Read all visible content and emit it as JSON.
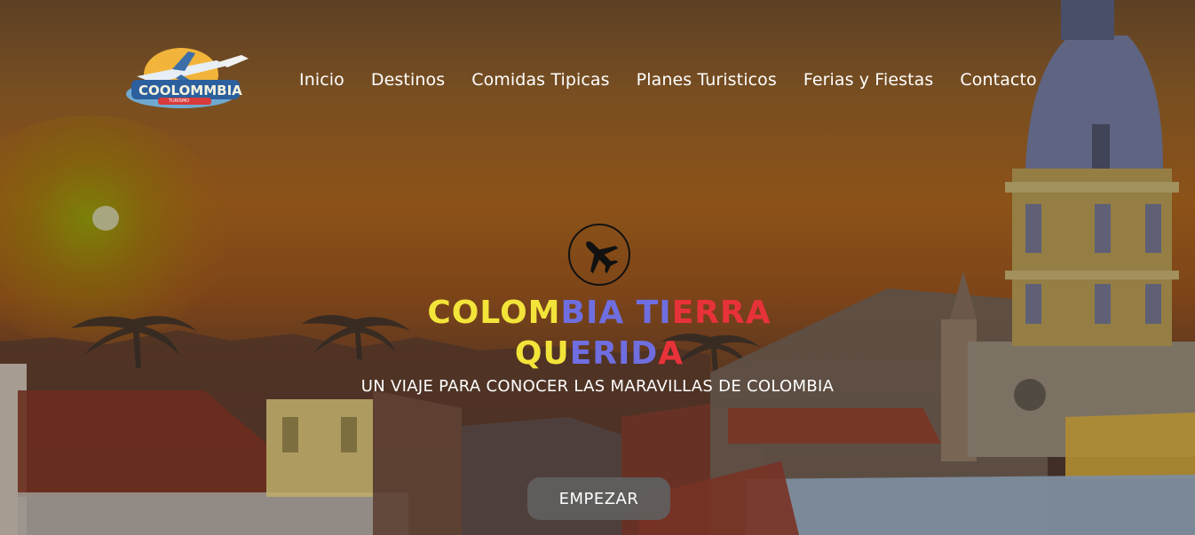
{
  "brand": {
    "logo_text": "COOLOMMBIA",
    "logo_tagline": "TURISMO",
    "logo_icon": "airplane-logo"
  },
  "nav": {
    "items": [
      {
        "label": "Inicio"
      },
      {
        "label": "Destinos"
      },
      {
        "label": "Comidas Tipicas"
      },
      {
        "label": "Planes Turisticos"
      },
      {
        "label": "Ferias y Fiestas"
      },
      {
        "label": "Contacto"
      }
    ]
  },
  "hero": {
    "icon": "airplane-icon",
    "title_line1": [
      "COLOM",
      "BIA TI",
      "ERRA"
    ],
    "title_line2": [
      "QU",
      "ERID",
      "A"
    ],
    "title_colors": {
      "yellow": "#f3e43a",
      "blue": "#6f6ee0",
      "red": "#e8323a"
    },
    "subtitle": "UN VIAJE PARA CONOCER LAS MARAVILLAS DE COLOMBIA",
    "cta_label": "EMPEZAR"
  }
}
